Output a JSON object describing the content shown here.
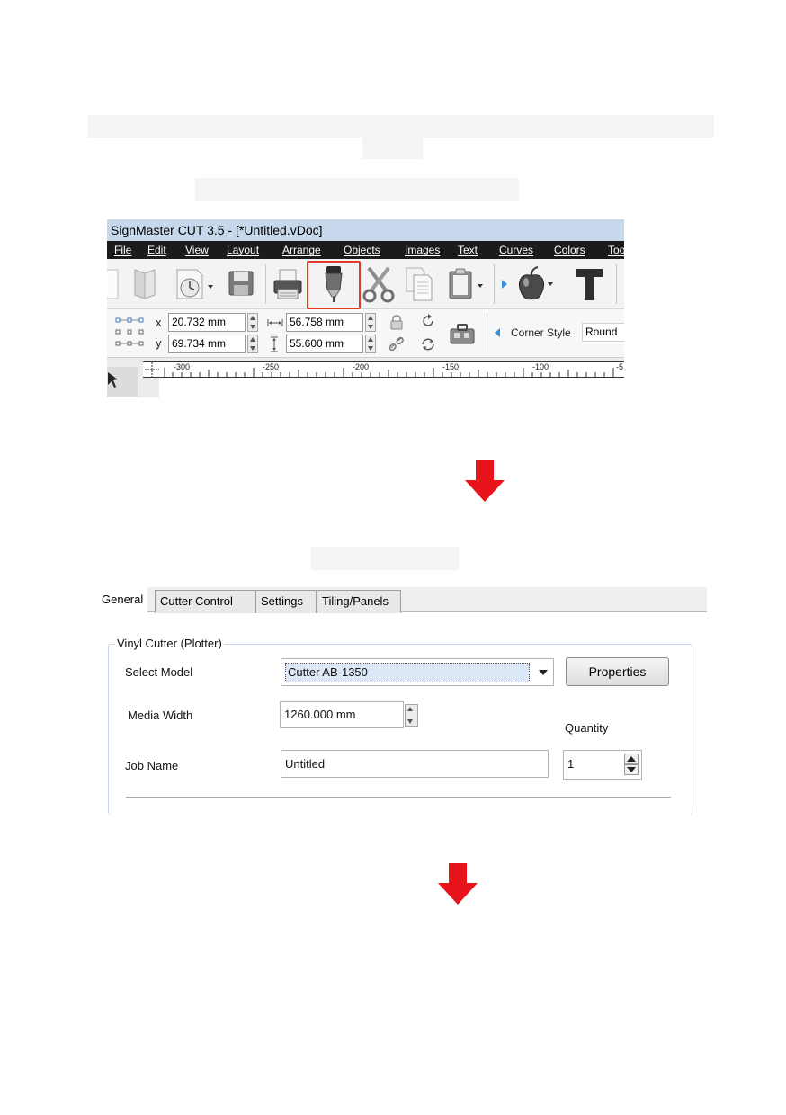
{
  "app": {
    "title": "SignMaster CUT 3.5 - [*Untitled.vDoc]",
    "menu": [
      "File",
      "Edit",
      "View",
      "Layout",
      "Arrange",
      "Objects",
      "Images",
      "Text",
      "Curves",
      "Colors",
      "Too"
    ],
    "props": {
      "x_label": "x",
      "y_label": "y",
      "x_value": "20.732 mm",
      "y_value": "69.734 mm",
      "width_value": "56.758 mm",
      "height_value": "55.600 mm",
      "corner_style_label": "Corner Style",
      "corner_style_value": "Round"
    },
    "ruler": [
      "-300",
      "-250",
      "-200",
      "-150",
      "-100",
      "-5"
    ],
    "toolbar_icons": [
      "page-icon",
      "book-icon",
      "clock-icon",
      "save-icon",
      "printer-icon",
      "cutter-icon",
      "scissors-icon",
      "copy-icon",
      "clipboard-icon",
      "apple-icon",
      "text-tool-icon"
    ],
    "highlight_color": "#e23a2a"
  },
  "dialog": {
    "tabs": [
      "General",
      "Cutter Control",
      "Settings",
      "Tiling/Panels"
    ],
    "group_title": "Vinyl Cutter (Plotter)",
    "select_model_label": "Select Model",
    "select_model_value": "Cutter AB-1350",
    "properties_button": "Properties",
    "media_width_label": "Media Width",
    "media_width_value": "1260.000 mm",
    "quantity_label": "Quantity",
    "job_name_label": "Job Name",
    "job_name_value": "Untitled",
    "quantity_value": "1"
  },
  "arrow_color": "#e8141b"
}
